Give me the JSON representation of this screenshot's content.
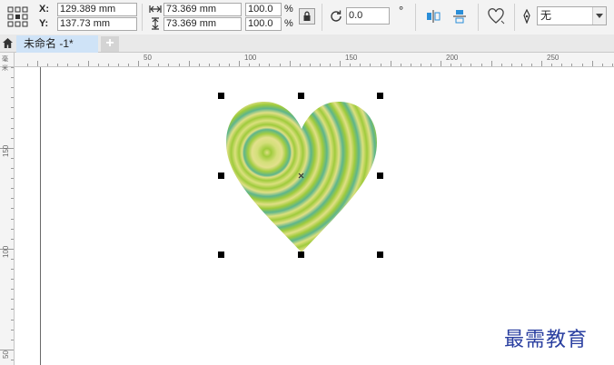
{
  "propbar": {
    "x_label": "X:",
    "x_value": "129.389 mm",
    "y_label": "Y:",
    "y_value": "137.73 mm",
    "width_value": "73.369 mm",
    "height_value": "73.369 mm",
    "scale_x": "100.0",
    "scale_y": "100.0",
    "percent": "%",
    "rotation_value": "0.0",
    "degree": "°",
    "outline_width_value": "无"
  },
  "tabs": {
    "document_tab": "未命名 -1*",
    "add_tab": "+"
  },
  "ruler": {
    "top_labels": [
      "50",
      "100",
      "150",
      "200",
      "250"
    ],
    "left_labels": [
      "150",
      "100",
      "50"
    ],
    "unit_label": "毫米"
  },
  "watermark": "最需教育",
  "colors": {
    "heart_green": "#9fcb3c",
    "heart_teal": "#5db58c",
    "heart_yellow": "#e0df86",
    "tab_active": "#cfe3f7"
  },
  "icons": [
    "origin-grid-icon",
    "width-icon",
    "height-icon",
    "lock-ratio-icon",
    "rotate-icon",
    "mirror-horizontal-icon",
    "mirror-vertical-icon",
    "contour-icon",
    "pen-icon",
    "home-icon"
  ]
}
